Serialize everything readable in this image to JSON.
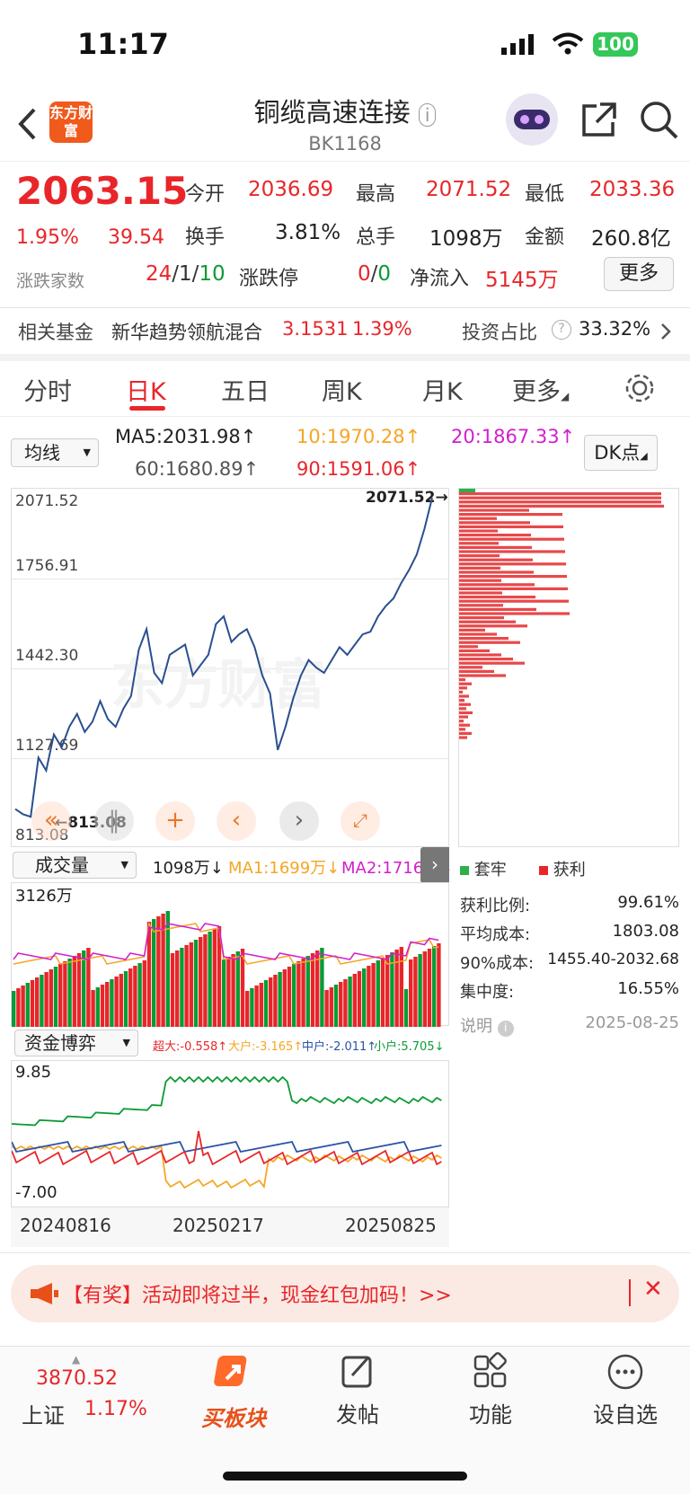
{
  "status_bar": {
    "time": "11:17",
    "battery": "100"
  },
  "header": {
    "title": "铜缆高速连接",
    "code": "BK1168",
    "logo_text": "东方财富"
  },
  "quote": {
    "price": "2063.15",
    "change_pct": "1.95%",
    "change": "39.54",
    "open_label": "今开",
    "open": "2036.69",
    "high_label": "最高",
    "high": "2071.52",
    "low_label": "最低",
    "low": "2033.36",
    "turnover_label": "换手",
    "turnover": "3.81%",
    "volume_label": "总手",
    "volume": "1098万",
    "amount_label": "金额",
    "amount": "260.8亿",
    "breadth_label": "涨跌家数",
    "breadth_up": "24",
    "breadth_flat": "1",
    "breadth_down": "10",
    "limit_label": "涨跌停",
    "limit_up": "0",
    "limit_down": "0",
    "inflow_label": "净流入",
    "inflow": "5145万",
    "more_button": "更多"
  },
  "fund": {
    "label": "相关基金",
    "name": "新华趋势领航混合",
    "nav": "3.1531",
    "pct": "1.39%",
    "ratio_label": "投资占比",
    "ratio": "33.32%"
  },
  "tabs": [
    "分时",
    "日K",
    "五日",
    "周K",
    "月K",
    "更多"
  ],
  "ma_bar": {
    "selector": "均线",
    "ma5": "MA5:2031.98↑",
    "ma10": "10:1970.28↑",
    "ma20": "20:1867.33↑",
    "ma60": "60:1680.89↑",
    "ma90": "90:1591.06↑",
    "dk": "DK点"
  },
  "price_axis": {
    "ticks": [
      "2071.52",
      "1756.91",
      "1442.30",
      "1127.69",
      "813.08"
    ],
    "max_marker": "2071.52",
    "min_marker": "813.08"
  },
  "volume_bar": {
    "selector": "成交量",
    "vol": "1098万↓",
    "ma1": "MA1:1699万↓",
    "ma2": "MA2:1716万↓",
    "max": "3126万"
  },
  "capital_bar": {
    "selector": "资金博弈",
    "super": "超大:-0.558↑",
    "big": "大户:-3.165↑",
    "mid": "中户:-2.011↑",
    "small": "小户:5.705↓",
    "max": "9.85",
    "min": "-7.00"
  },
  "dates": [
    "20240816",
    "20250217",
    "20250825"
  ],
  "chip": {
    "legend_trap": "套牢",
    "legend_profit": "获利",
    "profit_ratio_label": "获利比例:",
    "profit_ratio": "99.61%",
    "avg_cost_label": "平均成本:",
    "avg_cost": "1803.08",
    "cost90_label": "90%成本:",
    "cost90": "1455.40-2032.68",
    "concentration_label": "集中度:",
    "concentration": "16.55%",
    "note_label": "说明",
    "date": "2025-08-25"
  },
  "banner": {
    "text": "【有奖】活动即将过半，现金红包加码！>>"
  },
  "bottom_nav": {
    "index_value": "3870.52",
    "index_name": "上证",
    "index_pct": "1.17%",
    "buy": "买板块",
    "post": "发帖",
    "func": "功能",
    "watch": "设自选"
  },
  "chart_data": {
    "type": "line",
    "series": [
      {
        "values": [
          860,
          840,
          830,
          1060,
          1010,
          1150,
          1100,
          1180,
          1230,
          1160,
          1200,
          1280,
          1210,
          1180,
          1250,
          1300,
          1480,
          1560,
          1390,
          1350,
          1460,
          1480,
          1500,
          1380,
          1420,
          1460,
          1580,
          1610,
          1510,
          1540,
          1560,
          1490,
          1380,
          1310,
          1090,
          1180,
          1290,
          1380,
          1440,
          1410,
          1390,
          1440,
          1490,
          1460,
          1500,
          1540,
          1550,
          1610,
          1650,
          1680,
          1740,
          1790,
          1850,
          1950,
          2071
        ]
      }
    ],
    "ylim": [
      813.08,
      2071.52
    ]
  }
}
